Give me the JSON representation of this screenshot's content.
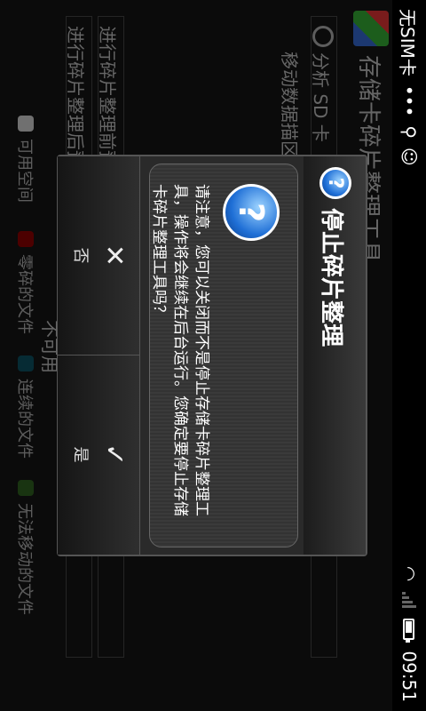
{
  "status_bar": {
    "carrier": "无SIM卡",
    "time": "09:51",
    "battery_level": 0.7,
    "icons": [
      "notification-icon",
      "usb-icon",
      "android-debug-icon",
      "wifi-icon",
      "signal-icon",
      "battery-icon"
    ]
  },
  "background_app": {
    "title": "存储卡碎片整理工具",
    "storage_label": "分析 SD 卡",
    "data_area_label": "移动数据描区",
    "before_label": "进行碎片整理前预",
    "after_label": "进行碎片整理后预",
    "unavailable_label": "不可用",
    "legend": [
      {
        "label": "可用空间",
        "color": "#cccccc"
      },
      {
        "label": "零碎的文件",
        "color": "#8b0000"
      },
      {
        "label": "连续的文件",
        "color": "#0b4f5f"
      },
      {
        "label": "无法移动的文件",
        "color": "#2f5f1f"
      }
    ]
  },
  "dialog": {
    "title": "停止碎片整理",
    "message": "请注意，您可以关闭而不是停止存储卡碎片整理工具，操作将会继续在后台运行。您确定要停止存储卡碎片整理工具吗？",
    "confirm_label": "是",
    "confirm_glyph": "✓",
    "cancel_label": "否",
    "cancel_glyph": "✕"
  }
}
